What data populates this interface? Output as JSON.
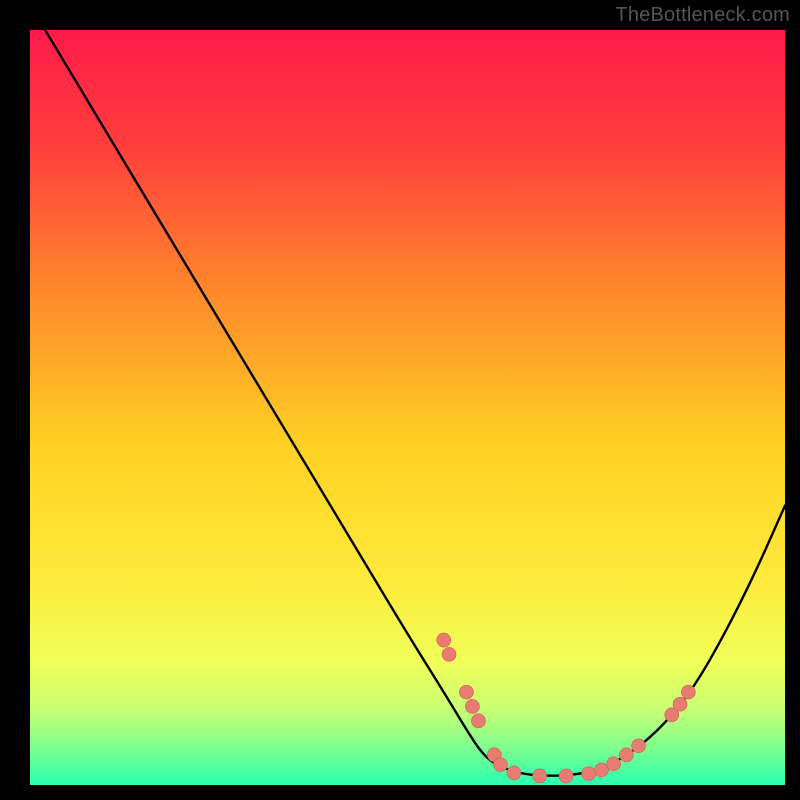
{
  "watermark": "TheBottleneck.com",
  "colors": {
    "bg": "#000000",
    "gradient_stops": [
      {
        "offset": "0%",
        "color": "#ff1a4a"
      },
      {
        "offset": "15%",
        "color": "#ff3d3d"
      },
      {
        "offset": "35%",
        "color": "#ff8a2b"
      },
      {
        "offset": "55%",
        "color": "#ffd124"
      },
      {
        "offset": "72%",
        "color": "#ffe93a"
      },
      {
        "offset": "84%",
        "color": "#f0ff59"
      },
      {
        "offset": "90%",
        "color": "#c8ff74"
      },
      {
        "offset": "95%",
        "color": "#7eff8e"
      },
      {
        "offset": "100%",
        "color": "#2bffb0"
      }
    ],
    "curve": "#000000",
    "dot_fill": "#e87b72",
    "dot_stroke": "#c96058"
  },
  "chart_data": {
    "type": "line",
    "title": "",
    "xlabel": "",
    "ylabel": "",
    "xlim": [
      0,
      100
    ],
    "ylim": [
      0,
      100
    ],
    "series": [
      {
        "name": "curve",
        "x": [
          2,
          8,
          14,
          20,
          26,
          32,
          38,
          44,
          50,
          55,
          58,
          60,
          62,
          65,
          68,
          72,
          76,
          80,
          84,
          88,
          92,
          96,
          100
        ],
        "y": [
          100,
          90,
          80,
          70,
          60,
          50,
          40,
          30,
          20,
          12,
          7,
          4,
          2.5,
          1.5,
          1.2,
          1.3,
          2.2,
          4.5,
          8,
          13,
          20,
          28,
          37
        ]
      }
    ],
    "scatter": [
      {
        "x": 54.8,
        "y": 19.2
      },
      {
        "x": 55.5,
        "y": 17.3
      },
      {
        "x": 57.8,
        "y": 12.3
      },
      {
        "x": 58.6,
        "y": 10.4
      },
      {
        "x": 59.4,
        "y": 8.5
      },
      {
        "x": 61.5,
        "y": 4.0
      },
      {
        "x": 62.3,
        "y": 2.7
      },
      {
        "x": 64.1,
        "y": 1.6
      },
      {
        "x": 67.5,
        "y": 1.2
      },
      {
        "x": 71.0,
        "y": 1.2
      },
      {
        "x": 74.0,
        "y": 1.5
      },
      {
        "x": 75.7,
        "y": 2.0
      },
      {
        "x": 77.3,
        "y": 2.8
      },
      {
        "x": 79.0,
        "y": 4.0
      },
      {
        "x": 80.6,
        "y": 5.2
      },
      {
        "x": 85.0,
        "y": 9.3
      },
      {
        "x": 86.1,
        "y": 10.7
      },
      {
        "x": 87.2,
        "y": 12.3
      }
    ],
    "dot_radius": 7
  }
}
